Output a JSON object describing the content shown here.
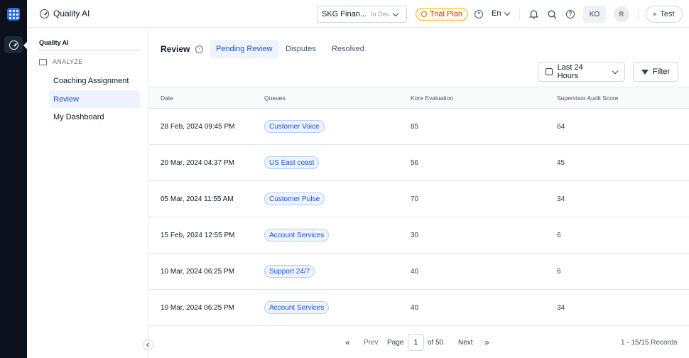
{
  "app": {
    "title": "Quality AI"
  },
  "header": {
    "workspace_name": "SKG Finan...",
    "workspace_env": "In Dev",
    "trial_label": "Trial Plan",
    "language": "En",
    "user_initials": "KO",
    "secondary_initials": "R",
    "test_label": "Test"
  },
  "nav": {
    "title": "Quality AI",
    "section": "ANALYZE",
    "items": [
      {
        "label": "Coaching Assignment"
      },
      {
        "label": "Review"
      },
      {
        "label": "My Dashboard"
      }
    ]
  },
  "main": {
    "title": "Review",
    "tabs": [
      {
        "label": "Pending Review"
      },
      {
        "label": "Disputes"
      },
      {
        "label": "Resolved"
      }
    ],
    "time_filter": "Last 24 Hours",
    "filter_label": "Filter",
    "columns": [
      "Date",
      "Queues",
      "Kore Evaluation",
      "Supervisor Audit Score"
    ],
    "rows": [
      {
        "date": "28 Feb, 2024 09:45 PM",
        "queue": "Customer Voice",
        "kore": "85",
        "audit": "64"
      },
      {
        "date": "20 Mar, 2024 04:37 PM",
        "queue": "US East coast",
        "kore": "56",
        "audit": "45"
      },
      {
        "date": "05 Mar, 2024 11:55 AM",
        "queue": "Customer Pulse",
        "kore": "70",
        "audit": "34"
      },
      {
        "date": "15 Feb, 2024 12:55 PM",
        "queue": "Account Services",
        "kore": "30",
        "audit": "6"
      },
      {
        "date": "10 Mar, 2024 06:25 PM",
        "queue": "Support 24/7",
        "kore": "40",
        "audit": "6"
      },
      {
        "date": "10 Mar, 2024 06:25 PM",
        "queue": "Account Services",
        "kore": "40",
        "audit": "34"
      }
    ]
  },
  "pagination": {
    "prev_label": "Prev",
    "page_label": "Page",
    "current_page": "1",
    "of_label": "of 50",
    "next_label": "Next",
    "records": "1 - 15/15 Records"
  }
}
